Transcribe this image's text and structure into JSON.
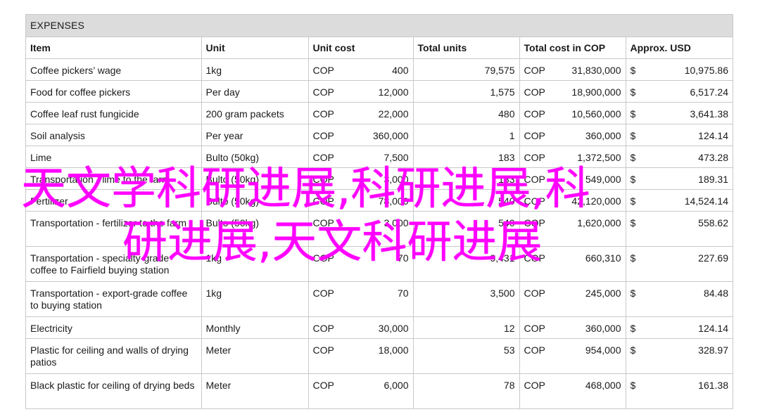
{
  "sheet": {
    "title": "EXPENSES",
    "headers": [
      "Item",
      "Unit",
      "Unit cost",
      "Total units",
      "Total cost in COP",
      "Approx. USD"
    ],
    "rows": [
      {
        "item": "Coffee pickers’ wage",
        "unit": "1kg",
        "unit_cost_cur": "COP",
        "unit_cost": "400",
        "total_units": "79,575",
        "total_cost_cur": "COP",
        "total_cost": "31,830,000",
        "usd_cur": "$",
        "usd": "10,975.86",
        "lines": 1
      },
      {
        "item": "Food for coffee pickers",
        "unit": "Per day",
        "unit_cost_cur": "COP",
        "unit_cost": "12,000",
        "total_units": "1,575",
        "total_cost_cur": "COP",
        "total_cost": "18,900,000",
        "usd_cur": "$",
        "usd": "6,517.24",
        "lines": 1
      },
      {
        "item": "Coffee leaf rust fungicide",
        "unit": "200 gram packets",
        "unit_cost_cur": "COP",
        "unit_cost": "22,000",
        "total_units": "480",
        "total_cost_cur": "COP",
        "total_cost": "10,560,000",
        "usd_cur": "$",
        "usd": "3,641.38",
        "lines": 1
      },
      {
        "item": "Soil analysis",
        "unit": "Per year",
        "unit_cost_cur": "COP",
        "unit_cost": "360,000",
        "total_units": "1",
        "total_cost_cur": "COP",
        "total_cost": "360,000",
        "usd_cur": "$",
        "usd": "124.14",
        "lines": 1
      },
      {
        "item": "Lime",
        "unit": "Bulto (50kg)",
        "unit_cost_cur": "COP",
        "unit_cost": "7,500",
        "total_units": "183",
        "total_cost_cur": "COP",
        "total_cost": "1,372,500",
        "usd_cur": "$",
        "usd": "473.28",
        "lines": 1
      },
      {
        "item": "Transportation - lime to the farm",
        "unit": "Bulto (50kg)",
        "unit_cost_cur": "COP",
        "unit_cost": "3,000",
        "total_units": "183",
        "total_cost_cur": "COP",
        "total_cost": "549,000",
        "usd_cur": "$",
        "usd": "189.31",
        "lines": 1
      },
      {
        "item": "Fertilizer",
        "unit": "Bulto (50kg)",
        "unit_cost_cur": "COP",
        "unit_cost": "78,000",
        "total_units": "540",
        "total_cost_cur": "COP",
        "total_cost": "42,120,000",
        "usd_cur": "$",
        "usd": "14,524.14",
        "lines": 1
      },
      {
        "item": "Transportation - fertilizer to the farm",
        "unit": "Bulto (50kg)",
        "unit_cost_cur": "COP",
        "unit_cost": "3,000",
        "total_units": "540",
        "total_cost_cur": "COP",
        "total_cost": "1,620,000",
        "usd_cur": "$",
        "usd": "558.62",
        "lines": 2
      },
      {
        "item": "Transportation - specialty-grade coffee to Fairfield buying station",
        "unit": "1kg",
        "unit_cost_cur": "COP",
        "unit_cost": "70",
        "total_units": "9,431",
        "total_cost_cur": "COP",
        "total_cost": "660,310",
        "usd_cur": "$",
        "usd": "227.69",
        "lines": 2
      },
      {
        "item": "Transportation - export-grade coffee to buying station",
        "unit": "1kg",
        "unit_cost_cur": "COP",
        "unit_cost": "70",
        "total_units": "3,500",
        "total_cost_cur": "COP",
        "total_cost": "245,000",
        "usd_cur": "$",
        "usd": "84.48",
        "lines": 2
      },
      {
        "item": "Electricity",
        "unit": "Monthly",
        "unit_cost_cur": "COP",
        "unit_cost": "30,000",
        "total_units": "12",
        "total_cost_cur": "COP",
        "total_cost": "360,000",
        "usd_cur": "$",
        "usd": "124.14",
        "lines": 1
      },
      {
        "item": "Plastic for ceiling and walls of drying patios",
        "unit": "Meter",
        "unit_cost_cur": "COP",
        "unit_cost": "18,000",
        "total_units": "53",
        "total_cost_cur": "COP",
        "total_cost": "954,000",
        "usd_cur": "$",
        "usd": "328.97",
        "lines": 2
      },
      {
        "item": "Black plastic for ceiling of drying beds",
        "unit": "Meter",
        "unit_cost_cur": "COP",
        "unit_cost": "6,000",
        "total_units": "78",
        "total_cost_cur": "COP",
        "total_cost": "468,000",
        "usd_cur": "$",
        "usd": "161.38",
        "lines": 2
      }
    ]
  },
  "watermark": {
    "line1": "天文学科研进展,科研进展,科",
    "line2": "研进展,天文科研进展",
    "color": "#ff00ff"
  }
}
